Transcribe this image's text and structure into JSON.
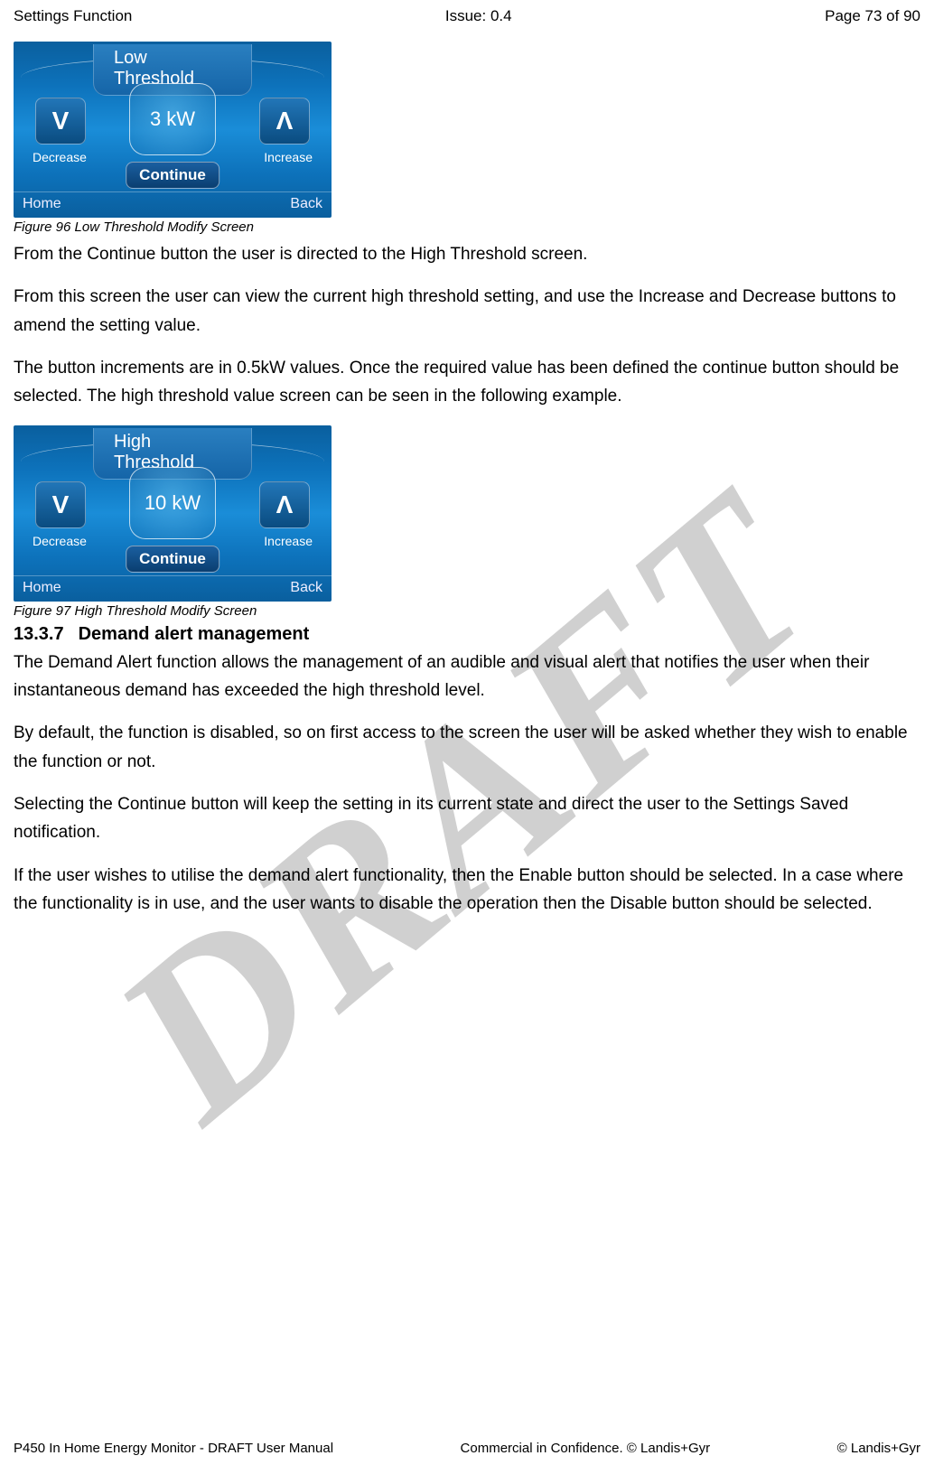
{
  "header": {
    "left": "Settings Function",
    "center": "Issue: 0.4",
    "right": "Page 73 of 90"
  },
  "watermark": "DRAFT",
  "screen1": {
    "title": "Low Threshold",
    "value": "3 kW",
    "decrease_label": "Decrease",
    "increase_label": "Increase",
    "continue": "Continue",
    "home": "Home",
    "back": "Back"
  },
  "caption1": "Figure 96 Low Threshold Modify Screen",
  "p1": "From the Continue button the user is directed to the High Threshold screen.",
  "p2": "From this screen the user can view the current high threshold setting, and use the Increase and Decrease buttons to amend the setting value.",
  "p3": "The button increments are in 0.5kW values. Once the required value has been defined the continue button should be selected. The high threshold value screen can be seen in the following example.",
  "screen2": {
    "title": "High Threshold",
    "value": "10 kW",
    "decrease_label": "Decrease",
    "increase_label": "Increase",
    "continue": "Continue",
    "home": "Home",
    "back": "Back"
  },
  "caption2": "Figure 97 High Threshold Modify Screen",
  "section": {
    "number": "13.3.7",
    "title": "Demand alert management"
  },
  "p4": "The Demand Alert function allows the management of an audible and visual alert that notifies the user when their instantaneous demand has exceeded the high threshold level.",
  "p5": "By default, the function is disabled, so on first access to the screen the user will be asked whether they wish to enable the function or not.",
  "p6": "Selecting the Continue button will keep the setting in its current state and direct the user to the Settings Saved notification.",
  "p7": "If the user wishes to utilise the demand alert functionality, then the Enable button should be selected. In a case where the functionality is in use, and the user wants to disable the operation then the Disable button should be selected.",
  "footer": {
    "left": "P450 In Home Energy Monitor - DRAFT User Manual",
    "center": "Commercial in Confidence. © Landis+Gyr",
    "right": "© Landis+Gyr"
  }
}
